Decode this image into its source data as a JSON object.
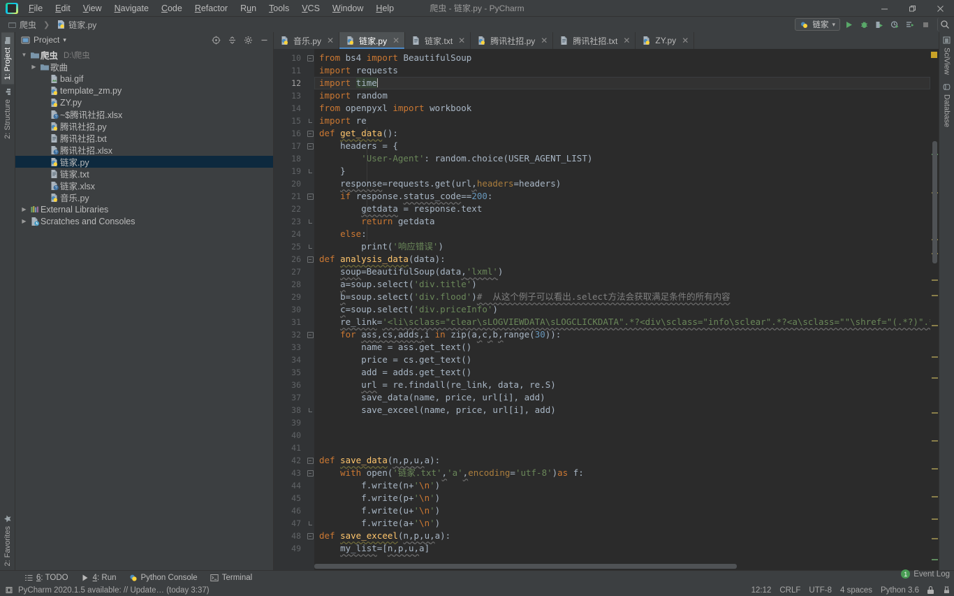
{
  "window": {
    "title": "爬虫 - 链家.py - PyCharm",
    "minimize": "—",
    "maximize": "❐",
    "close": "✕"
  },
  "menubar": [
    {
      "label": "File"
    },
    {
      "label": "Edit"
    },
    {
      "label": "View"
    },
    {
      "label": "Navigate"
    },
    {
      "label": "Code"
    },
    {
      "label": "Refactor"
    },
    {
      "label": "Run"
    },
    {
      "label": "Tools"
    },
    {
      "label": "VCS"
    },
    {
      "label": "Window"
    },
    {
      "label": "Help"
    }
  ],
  "breadcrumb": {
    "project": "爬虫",
    "separator": "❯",
    "file": "链家.py"
  },
  "toolbar": {
    "run_config": "链家",
    "dropdown_arrow": "▾",
    "icons": [
      "run-icon",
      "debug-icon",
      "coverage-icon",
      "profile-icon",
      "run-with-console-icon",
      "stop-icon",
      "search-everywhere-icon"
    ]
  },
  "left_strip": {
    "top": [
      {
        "label": "1: Project",
        "active": true,
        "icon": "project-icon"
      },
      {
        "label": "2: Structure",
        "active": false,
        "icon": "structure-icon"
      }
    ],
    "bottom": [
      {
        "label": "2: Favorites",
        "active": false,
        "icon": "star-icon"
      }
    ]
  },
  "right_strip": [
    {
      "label": "SciView",
      "icon": "sciview-icon"
    },
    {
      "label": "Database",
      "icon": "database-icon"
    }
  ],
  "project_panel": {
    "title": "Project",
    "dropdown": "▾",
    "header_icons": [
      "target-icon",
      "collapse-all-icon",
      "gear-icon",
      "hide-icon"
    ],
    "tree": [
      {
        "indent": 0,
        "arrow": "▼",
        "icon": "folder",
        "name": "爬虫",
        "bold": true,
        "path": "D:\\爬虫",
        "selected": false
      },
      {
        "indent": 1,
        "arrow": "▶",
        "icon": "folder",
        "name": "歌曲",
        "bold": false,
        "path": "",
        "selected": false
      },
      {
        "indent": 2,
        "arrow": "",
        "icon": "file-gif",
        "name": "bai.gif",
        "bold": false,
        "path": "",
        "selected": false
      },
      {
        "indent": 2,
        "arrow": "",
        "icon": "file-py",
        "name": "template_zm.py",
        "bold": false,
        "path": "",
        "selected": false
      },
      {
        "indent": 2,
        "arrow": "",
        "icon": "file-py",
        "name": "ZY.py",
        "bold": false,
        "path": "",
        "selected": false
      },
      {
        "indent": 2,
        "arrow": "",
        "icon": "file-unknown",
        "name": "~$腾讯社招.xlsx",
        "bold": false,
        "path": "",
        "selected": false
      },
      {
        "indent": 2,
        "arrow": "",
        "icon": "file-py",
        "name": "腾讯社招.py",
        "bold": false,
        "path": "",
        "selected": false
      },
      {
        "indent": 2,
        "arrow": "",
        "icon": "file-txt",
        "name": "腾讯社招.txt",
        "bold": false,
        "path": "",
        "selected": false
      },
      {
        "indent": 2,
        "arrow": "",
        "icon": "file-unknown",
        "name": "腾讯社招.xlsx",
        "bold": false,
        "path": "",
        "selected": false
      },
      {
        "indent": 2,
        "arrow": "",
        "icon": "file-py",
        "name": "链家.py",
        "bold": false,
        "path": "",
        "selected": true
      },
      {
        "indent": 2,
        "arrow": "",
        "icon": "file-txt",
        "name": "链家.txt",
        "bold": false,
        "path": "",
        "selected": false
      },
      {
        "indent": 2,
        "arrow": "",
        "icon": "file-unknown",
        "name": "链家.xlsx",
        "bold": false,
        "path": "",
        "selected": false
      },
      {
        "indent": 2,
        "arrow": "",
        "icon": "file-py",
        "name": "音乐.py",
        "bold": false,
        "path": "",
        "selected": false
      },
      {
        "indent": 0,
        "arrow": "▶",
        "icon": "library",
        "name": "External Libraries",
        "bold": false,
        "path": "",
        "selected": false
      },
      {
        "indent": 0,
        "arrow": "▶",
        "icon": "scratch",
        "name": "Scratches and Consoles",
        "bold": false,
        "path": "",
        "selected": false
      }
    ]
  },
  "editor_tabs": [
    {
      "label": "音乐.py",
      "icon": "file-py",
      "active": false,
      "close": "✕"
    },
    {
      "label": "链家.py",
      "icon": "file-py",
      "active": true,
      "close": "✕"
    },
    {
      "label": "链家.txt",
      "icon": "file-txt",
      "active": false,
      "close": "✕"
    },
    {
      "label": "腾讯社招.py",
      "icon": "file-py",
      "active": false,
      "close": "✕"
    },
    {
      "label": "腾讯社招.txt",
      "icon": "file-txt",
      "active": false,
      "close": "✕"
    },
    {
      "label": "ZY.py",
      "icon": "file-py",
      "active": false,
      "close": "✕"
    }
  ],
  "editor": {
    "first_line_number": 10,
    "current_line": 12,
    "lines": [
      {
        "n": 10,
        "fold": "start",
        "html": "<span class=\"kw\">from</span> <span class=\"ident\">bs4</span> <span class=\"kw\">import</span> <span class=\"ident\">BeautifulSoup</span>"
      },
      {
        "n": 11,
        "fold": "",
        "html": "<span class=\"kw\">import</span> <span class=\"ident\">requests</span>"
      },
      {
        "n": 12,
        "fold": "",
        "html": "<span class=\"kw\">import</span> <span class=\"ident hl-w\">time</span><span class=\"caret\"></span>"
      },
      {
        "n": 13,
        "fold": "",
        "html": "<span class=\"kw\">import</span> <span class=\"ident\">random</span>"
      },
      {
        "n": 14,
        "fold": "",
        "html": "<span class=\"kw\">from</span> <span class=\"ident\">openpyxl</span> <span class=\"kw\">import</span> <span class=\"ident\">workbook</span>"
      },
      {
        "n": 15,
        "fold": "end",
        "html": "<span class=\"kw\">import</span> <span class=\"ident\">re</span>"
      },
      {
        "n": 16,
        "fold": "start",
        "html": "<span class=\"kw\">def</span> <span class=\"fn err-u\">get_data</span><span class=\"pun\">():</span>"
      },
      {
        "n": 17,
        "fold": "start",
        "html": "    <span class=\"ident\">headers</span> <span class=\"pun\">= {</span>"
      },
      {
        "n": 18,
        "fold": "",
        "html": "        <span class=\"str\">'User-Agent'</span><span class=\"pun\">: </span><span class=\"ident\">random</span><span class=\"pun\">.</span><span class=\"ident\">choice</span><span class=\"pun\">(</span><span class=\"ident\">USER_AGENT_LIST</span><span class=\"pun\">)</span>"
      },
      {
        "n": 19,
        "fold": "end",
        "html": "    <span class=\"pun\">}</span>"
      },
      {
        "n": 20,
        "fold": "",
        "html": "    <span class=\"ident spell\">response</span><span class=\"pun\">=</span><span class=\"ident\">requests</span><span class=\"pun\">.</span><span class=\"ident\">get</span><span class=\"pun\">(</span><span class=\"ident\">url</span><span class=\"pun spell\">,</span><span class=\"param\">headers</span><span class=\"pun\">=</span><span class=\"ident\">headers</span><span class=\"pun\">)</span>"
      },
      {
        "n": 21,
        "fold": "start",
        "html": "    <span class=\"kw\">if</span> <span class=\"ident\">response</span><span class=\"pun\">.</span><span class=\"ident spell\">status_code</span><span class=\"pun\">==</span><span class=\"num\">200</span><span class=\"pun\">:</span>"
      },
      {
        "n": 22,
        "fold": "",
        "html": "        <span class=\"ident spell\">getdata</span> <span class=\"pun\">= </span><span class=\"ident\">response</span><span class=\"pun\">.</span><span class=\"ident\">text</span>"
      },
      {
        "n": 23,
        "fold": "end",
        "html": "        <span class=\"kw\">return</span> <span class=\"ident\">getdata</span>"
      },
      {
        "n": 24,
        "fold": "",
        "html": "    <span class=\"kw\">else</span><span class=\"pun\">:</span>"
      },
      {
        "n": 25,
        "fold": "end",
        "html": "        <span class=\"ident\">print</span><span class=\"pun\">(</span><span class=\"str\">'响应错误'</span><span class=\"pun\">)</span>"
      },
      {
        "n": 26,
        "fold": "start",
        "html": "<span class=\"kw\">def</span> <span class=\"fn err-u\">analysis_data</span><span class=\"pun\">(</span><span class=\"ident\">data</span><span class=\"pun\">):</span>"
      },
      {
        "n": 27,
        "fold": "",
        "html": "    <span class=\"ident spell\">soup</span><span class=\"pun\">=</span><span class=\"ident\">BeautifulSoup</span><span class=\"pun\">(</span><span class=\"ident\">data</span><span class=\"pun spell\">,</span><span class=\"str spell\">'lxml'</span><span class=\"pun\">)</span>"
      },
      {
        "n": 28,
        "fold": "",
        "html": "    <span class=\"ident spell\">a</span><span class=\"pun\">=</span><span class=\"ident\">soup</span><span class=\"pun\">.</span><span class=\"ident\">select</span><span class=\"pun\">(</span><span class=\"str\">'div.title'</span><span class=\"pun\">)</span>"
      },
      {
        "n": 29,
        "fold": "",
        "html": "    <span class=\"ident spell\">b</span><span class=\"pun\">=</span><span class=\"ident\">soup</span><span class=\"pun\">.</span><span class=\"ident\">select</span><span class=\"pun\">(</span><span class=\"str\">'div.flood'</span><span class=\"pun\">)</span><span class=\"com spell\">#  从这个例子可以看出.select方法会获取满足条件的所有内容</span>"
      },
      {
        "n": 30,
        "fold": "",
        "html": "    <span class=\"ident spell\">c</span><span class=\"pun\">=</span><span class=\"ident\">soup</span><span class=\"pun\">.</span><span class=\"ident\">select</span><span class=\"pun\">(</span><span class=\"str\">'div.priceInfo'</span><span class=\"pun\">)</span>"
      },
      {
        "n": 31,
        "fold": "",
        "html": "    <span class=\"ident spell\">re_link</span><span class=\"pun\">=</span><span class=\"str spell\">'&lt;li\\sclass=\"clear\\sLOGVIEWDATA\\sLOGCLICKDATA\".*?&lt;div\\sclass=\"info\\sclear\".*?&lt;a\\sclass=\"\"\\shref=\"(.*?)\".*?'</span>"
      },
      {
        "n": 32,
        "fold": "start",
        "html": "    <span class=\"kw\">for</span> <span class=\"ident spell\">ass</span><span class=\"pun spell\">,</span><span class=\"ident spell\">cs</span><span class=\"pun spell\">,</span><span class=\"ident spell\">adds</span><span class=\"pun spell\">,</span><span class=\"ident\">i</span> <span class=\"kw\">in</span> <span class=\"ident\">zip</span><span class=\"pun\">(</span><span class=\"ident\">a</span><span class=\"pun spell\">,</span><span class=\"ident\">c</span><span class=\"pun spell\">,</span><span class=\"ident\">b</span><span class=\"pun spell\">,</span><span class=\"ident\">range</span><span class=\"pun\">(</span><span class=\"num\">30</span><span class=\"pun\">)):</span>"
      },
      {
        "n": 33,
        "fold": "",
        "html": "        <span class=\"ident\">name</span> <span class=\"pun\">= </span><span class=\"ident\">ass</span><span class=\"pun\">.</span><span class=\"ident\">get_text</span><span class=\"pun\">()</span>"
      },
      {
        "n": 34,
        "fold": "",
        "html": "        <span class=\"ident\">price</span> <span class=\"pun\">= </span><span class=\"ident\">cs</span><span class=\"pun\">.</span><span class=\"ident\">get_text</span><span class=\"pun\">()</span>"
      },
      {
        "n": 35,
        "fold": "",
        "html": "        <span class=\"ident\">add</span> <span class=\"pun\">= </span><span class=\"ident\">adds</span><span class=\"pun\">.</span><span class=\"ident\">get_text</span><span class=\"pun\">()</span>"
      },
      {
        "n": 36,
        "fold": "",
        "html": "        <span class=\"ident spell\">url</span> <span class=\"pun\">= </span><span class=\"ident\">re</span><span class=\"pun\">.</span><span class=\"ident\">findall</span><span class=\"pun\">(</span><span class=\"ident\">re_link</span><span class=\"pun\">, </span><span class=\"ident\">data</span><span class=\"pun\">, </span><span class=\"ident\">re</span><span class=\"pun\">.</span><span class=\"ident\">S</span><span class=\"pun\">)</span>"
      },
      {
        "n": 37,
        "fold": "",
        "html": "        <span class=\"ident\">save_data</span><span class=\"pun\">(</span><span class=\"ident\">name</span><span class=\"pun\">, </span><span class=\"ident\">price</span><span class=\"pun\">, </span><span class=\"ident\">url</span><span class=\"pun\">[</span><span class=\"ident\">i</span><span class=\"pun\">], </span><span class=\"ident\">add</span><span class=\"pun\">)</span>"
      },
      {
        "n": 38,
        "fold": "end",
        "html": "        <span class=\"ident\">save_exceel</span><span class=\"pun\">(</span><span class=\"ident\">name</span><span class=\"pun\">, </span><span class=\"ident\">price</span><span class=\"pun\">, </span><span class=\"ident\">url</span><span class=\"pun\">[</span><span class=\"ident\">i</span><span class=\"pun\">], </span><span class=\"ident\">add</span><span class=\"pun\">)</span>"
      },
      {
        "n": 39,
        "fold": "",
        "html": ""
      },
      {
        "n": 40,
        "fold": "",
        "html": ""
      },
      {
        "n": 41,
        "fold": "",
        "html": ""
      },
      {
        "n": 42,
        "fold": "start",
        "html": "<span class=\"kw\">def</span> <span class=\"fn err-u\">save_data</span><span class=\"pun\">(</span><span class=\"ident spell\">n</span><span class=\"pun spell\">,</span><span class=\"ident spell\">p</span><span class=\"pun spell\">,</span><span class=\"ident spell\">u</span><span class=\"pun spell\">,</span><span class=\"ident\">a</span><span class=\"pun\">):</span>"
      },
      {
        "n": 43,
        "fold": "start",
        "html": "    <span class=\"kw\">with</span> <span class=\"ident\">open</span><span class=\"pun\">(</span><span class=\"str\">'链家.txt'</span><span class=\"pun spell\">,</span><span class=\"str\">'a'</span><span class=\"pun spell\">,</span><span class=\"param\">encoding</span><span class=\"pun\">=</span><span class=\"str\">'utf-8'</span><span class=\"pun\">)</span><span class=\"kw\">as</span> <span class=\"ident\">f</span><span class=\"pun\">:</span>"
      },
      {
        "n": 44,
        "fold": "",
        "html": "        <span class=\"ident\">f</span><span class=\"pun\">.</span><span class=\"ident\">write</span><span class=\"pun\">(</span><span class=\"ident\">n</span><span class=\"pun\">+</span><span class=\"str\">'</span><span class=\"esc\">\\n</span><span class=\"str\">'</span><span class=\"pun\">)</span>"
      },
      {
        "n": 45,
        "fold": "",
        "html": "        <span class=\"ident\">f</span><span class=\"pun\">.</span><span class=\"ident\">write</span><span class=\"pun\">(</span><span class=\"ident\">p</span><span class=\"pun\">+</span><span class=\"str\">'</span><span class=\"esc\">\\n</span><span class=\"str\">'</span><span class=\"pun\">)</span>"
      },
      {
        "n": 46,
        "fold": "",
        "html": "        <span class=\"ident\">f</span><span class=\"pun\">.</span><span class=\"ident\">write</span><span class=\"pun\">(</span><span class=\"ident\">u</span><span class=\"pun\">+</span><span class=\"str\">'</span><span class=\"esc\">\\n</span><span class=\"str\">'</span><span class=\"pun\">)</span>"
      },
      {
        "n": 47,
        "fold": "end",
        "html": "        <span class=\"ident\">f</span><span class=\"pun\">.</span><span class=\"ident\">write</span><span class=\"pun\">(</span><span class=\"ident\">a</span><span class=\"pun\">+</span><span class=\"str\">'</span><span class=\"esc\">\\n</span><span class=\"str\">'</span><span class=\"pun\">)</span>"
      },
      {
        "n": 48,
        "fold": "start",
        "html": "<span class=\"kw\">def</span> <span class=\"fn err-u\">save_exceel</span><span class=\"pun\">(</span><span class=\"ident spell\">n</span><span class=\"pun spell\">,</span><span class=\"ident spell\">p</span><span class=\"pun spell\">,</span><span class=\"ident spell\">u</span><span class=\"pun spell\">,</span><span class=\"ident\">a</span><span class=\"pun\">):</span>"
      },
      {
        "n": 49,
        "fold": "",
        "html": "    <span class=\"ident spell\">my_list</span><span class=\"pun\">=[</span><span class=\"ident spell\">n</span><span class=\"pun spell\">,</span><span class=\"ident spell\">p</span><span class=\"pun spell\">,</span><span class=\"ident spell\">u</span><span class=\"pun spell\">,</span><span class=\"ident\">a</span><span class=\"pun\">]</span>"
      }
    ]
  },
  "tool_window_bar": [
    {
      "label": "6: TODO",
      "underline": "6",
      "icon": "todo-icon"
    },
    {
      "label": "4: Run",
      "underline": "4",
      "icon": "run-icon"
    },
    {
      "label": "Python Console",
      "underline": "",
      "icon": "python-console-icon"
    },
    {
      "label": "Terminal",
      "underline": "",
      "icon": "terminal-icon"
    }
  ],
  "status_bar": {
    "message": "PyCharm 2020.1.5 available: // Update… (today 3:37)",
    "event_log": {
      "label": "Event Log",
      "count": "1"
    },
    "position": "12:12",
    "line_separator": "CRLF",
    "encoding": "UTF-8",
    "indent": "4 spaces",
    "interpreter": "Python 3.6",
    "lock_icon": "lock-icon",
    "inspection_icon": "inspections-icon"
  }
}
